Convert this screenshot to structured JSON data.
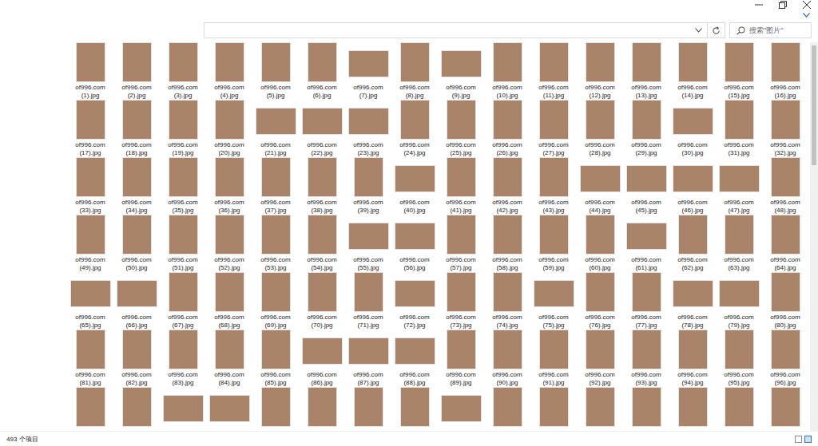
{
  "search": {
    "placeholder": "搜索\"图片\""
  },
  "files": [
    {
      "name": "of996.com (1).jpg",
      "kind": "portrait"
    },
    {
      "name": "of996.com (2).jpg",
      "kind": "portrait"
    },
    {
      "name": "of996.com (3).jpg",
      "kind": "portrait"
    },
    {
      "name": "of996.com (4).jpg",
      "kind": "portrait"
    },
    {
      "name": "of996.com (5).jpg",
      "kind": "portrait"
    },
    {
      "name": "of996.com (6).jpg",
      "kind": "portrait"
    },
    {
      "name": "of996.com (7).jpg",
      "kind": "landscape"
    },
    {
      "name": "of996.com (8).jpg",
      "kind": "portrait"
    },
    {
      "name": "of996.com (9).jpg",
      "kind": "landscape"
    },
    {
      "name": "of996.com (10).jpg",
      "kind": "portrait"
    },
    {
      "name": "of996.com (11).jpg",
      "kind": "portrait"
    },
    {
      "name": "of996.com (12).jpg",
      "kind": "portrait"
    },
    {
      "name": "of996.com (13).jpg",
      "kind": "portrait"
    },
    {
      "name": "of996.com (14).jpg",
      "kind": "portrait"
    },
    {
      "name": "of996.com (15).jpg",
      "kind": "portrait"
    },
    {
      "name": "of996.com (16).jpg",
      "kind": "portrait"
    },
    {
      "name": "of996.com (17).jpg",
      "kind": "portrait"
    },
    {
      "name": "of996.com (18).jpg",
      "kind": "portrait"
    },
    {
      "name": "of996.com (19).jpg",
      "kind": "portrait"
    },
    {
      "name": "of996.com (20).jpg",
      "kind": "portrait"
    },
    {
      "name": "of996.com (21).jpg",
      "kind": "landscape"
    },
    {
      "name": "of996.com (22).jpg",
      "kind": "landscape"
    },
    {
      "name": "of996.com (23).jpg",
      "kind": "landscape"
    },
    {
      "name": "of996.com (24).jpg",
      "kind": "portrait"
    },
    {
      "name": "of996.com (25).jpg",
      "kind": "portrait"
    },
    {
      "name": "of996.com (26).jpg",
      "kind": "portrait"
    },
    {
      "name": "of996.com (27).jpg",
      "kind": "portrait"
    },
    {
      "name": "of996.com (28).jpg",
      "kind": "portrait"
    },
    {
      "name": "of996.com (29).jpg",
      "kind": "portrait"
    },
    {
      "name": "of996.com (30).jpg",
      "kind": "landscape"
    },
    {
      "name": "of996.com (31).jpg",
      "kind": "portrait"
    },
    {
      "name": "of996.com (32).jpg",
      "kind": "portrait"
    },
    {
      "name": "of996.com (33).jpg",
      "kind": "portrait"
    },
    {
      "name": "of996.com (34).jpg",
      "kind": "portrait"
    },
    {
      "name": "of996.com (35).jpg",
      "kind": "portrait"
    },
    {
      "name": "of996.com (36).jpg",
      "kind": "portrait"
    },
    {
      "name": "of996.com (37).jpg",
      "kind": "portrait"
    },
    {
      "name": "of996.com (38).jpg",
      "kind": "portrait"
    },
    {
      "name": "of996.com (39).jpg",
      "kind": "portrait"
    },
    {
      "name": "of996.com (40).jpg",
      "kind": "landscape"
    },
    {
      "name": "of996.com (41).jpg",
      "kind": "portrait"
    },
    {
      "name": "of996.com (42).jpg",
      "kind": "portrait"
    },
    {
      "name": "of996.com (43).jpg",
      "kind": "portrait"
    },
    {
      "name": "of996.com (44).jpg",
      "kind": "landscape"
    },
    {
      "name": "of996.com (45).jpg",
      "kind": "landscape"
    },
    {
      "name": "of996.com (46).jpg",
      "kind": "landscape"
    },
    {
      "name": "of996.com (47).jpg",
      "kind": "landscape"
    },
    {
      "name": "of996.com (48).jpg",
      "kind": "portrait"
    },
    {
      "name": "of996.com (49).jpg",
      "kind": "portrait"
    },
    {
      "name": "of996.com (50).jpg",
      "kind": "portrait"
    },
    {
      "name": "of996.com (51).jpg",
      "kind": "portrait"
    },
    {
      "name": "of996.com (52).jpg",
      "kind": "portrait"
    },
    {
      "name": "of996.com (53).jpg",
      "kind": "portrait"
    },
    {
      "name": "of996.com (54).jpg",
      "kind": "portrait"
    },
    {
      "name": "of996.com (55).jpg",
      "kind": "landscape"
    },
    {
      "name": "of996.com (56).jpg",
      "kind": "landscape"
    },
    {
      "name": "of996.com (57).jpg",
      "kind": "portrait"
    },
    {
      "name": "of996.com (58).jpg",
      "kind": "portrait"
    },
    {
      "name": "of996.com (59).jpg",
      "kind": "portrait"
    },
    {
      "name": "of996.com (60).jpg",
      "kind": "portrait"
    },
    {
      "name": "of996.com (61).jpg",
      "kind": "landscape"
    },
    {
      "name": "of996.com (62).jpg",
      "kind": "portrait"
    },
    {
      "name": "of996.com (63).jpg",
      "kind": "portrait"
    },
    {
      "name": "of996.com (64).jpg",
      "kind": "portrait"
    },
    {
      "name": "of996.com (65).jpg",
      "kind": "landscape"
    },
    {
      "name": "of996.com (66).jpg",
      "kind": "landscape"
    },
    {
      "name": "of996.com (67).jpg",
      "kind": "portrait"
    },
    {
      "name": "of996.com (68).jpg",
      "kind": "portrait"
    },
    {
      "name": "of996.com (69).jpg",
      "kind": "portrait"
    },
    {
      "name": "of996.com (70).jpg",
      "kind": "portrait"
    },
    {
      "name": "of996.com (71).jpg",
      "kind": "portrait"
    },
    {
      "name": "of996.com (72).jpg",
      "kind": "landscape"
    },
    {
      "name": "of996.com (73).jpg",
      "kind": "portrait"
    },
    {
      "name": "of996.com (74).jpg",
      "kind": "portrait"
    },
    {
      "name": "of996.com (75).jpg",
      "kind": "landscape"
    },
    {
      "name": "of996.com (76).jpg",
      "kind": "portrait"
    },
    {
      "name": "of996.com (77).jpg",
      "kind": "portrait"
    },
    {
      "name": "of996.com (78).jpg",
      "kind": "landscape"
    },
    {
      "name": "of996.com (79).jpg",
      "kind": "landscape"
    },
    {
      "name": "of996.com (80).jpg",
      "kind": "portrait"
    },
    {
      "name": "of996.com (81).jpg",
      "kind": "portrait"
    },
    {
      "name": "of996.com (82).jpg",
      "kind": "portrait"
    },
    {
      "name": "of996.com (83).jpg",
      "kind": "portrait"
    },
    {
      "name": "of996.com (84).jpg",
      "kind": "portrait"
    },
    {
      "name": "of996.com (85).jpg",
      "kind": "portrait"
    },
    {
      "name": "of996.com (86).jpg",
      "kind": "landscape"
    },
    {
      "name": "of996.com (87).jpg",
      "kind": "landscape"
    },
    {
      "name": "of996.com (88).jpg",
      "kind": "landscape"
    },
    {
      "name": "of996.com (89).jpg",
      "kind": "portrait"
    },
    {
      "name": "of996.com (90).jpg",
      "kind": "portrait"
    },
    {
      "name": "of996.com (91).jpg",
      "kind": "portrait"
    },
    {
      "name": "of996.com (92).jpg",
      "kind": "portrait"
    },
    {
      "name": "of996.com (93).jpg",
      "kind": "portrait"
    },
    {
      "name": "of996.com (94).jpg",
      "kind": "portrait"
    },
    {
      "name": "of996.com (95).jpg",
      "kind": "portrait"
    },
    {
      "name": "of996.com (96).jpg",
      "kind": "portrait"
    },
    {
      "kind": "portrait"
    },
    {
      "kind": "portrait"
    },
    {
      "kind": "landscape"
    },
    {
      "kind": "landscape"
    },
    {
      "kind": "portrait"
    },
    {
      "kind": "portrait"
    },
    {
      "kind": "portrait"
    },
    {
      "kind": "portrait"
    },
    {
      "kind": "landscape"
    },
    {
      "kind": "portrait"
    },
    {
      "kind": "portrait"
    },
    {
      "kind": "portrait"
    },
    {
      "kind": "portrait"
    },
    {
      "kind": "portrait"
    },
    {
      "kind": "portrait"
    },
    {
      "kind": "portrait"
    }
  ],
  "status_bar": {
    "count": "493 个项目"
  }
}
